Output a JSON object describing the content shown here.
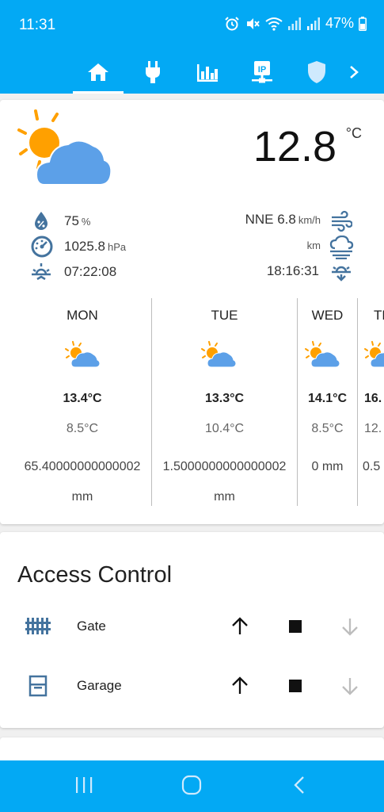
{
  "status_bar": {
    "time": "11:31",
    "battery": "47%"
  },
  "tabs": [
    {
      "icon": "home-icon",
      "active": true
    },
    {
      "icon": "plug-icon",
      "active": false
    },
    {
      "icon": "bar-chart-icon",
      "active": false
    },
    {
      "icon": "ip-network-icon",
      "active": false
    },
    {
      "icon": "shield-icon",
      "active": false
    },
    {
      "icon": "chevron-right-icon",
      "active": false
    }
  ],
  "weather": {
    "current_temp": "12.8",
    "temp_unit": "°C",
    "humidity": "75",
    "humidity_unit": "%",
    "pressure": "1025.8",
    "pressure_unit": "hPa",
    "sunrise": "07:22:08",
    "wind": "NNE 6.8",
    "wind_unit": "km/h",
    "visibility_unit": "km",
    "sunset": "18:16:31",
    "forecast": [
      {
        "day": "MON",
        "high": "13.4°C",
        "low": "8.5°C",
        "rain": "65.40000000000002",
        "rain_unit": "mm"
      },
      {
        "day": "TUE",
        "high": "13.3°C",
        "low": "10.4°C",
        "rain": "1.5000000000000002",
        "rain_unit": "mm"
      },
      {
        "day": "WED",
        "high": "14.1°C",
        "low": "8.5°C",
        "rain": "0 mm",
        "rain_unit": ""
      },
      {
        "day": "THU",
        "high": "16.",
        "low": "12.",
        "rain": "0.5",
        "rain_unit": ""
      }
    ]
  },
  "access_control": {
    "title": "Access Control",
    "items": [
      {
        "label": "Gate",
        "icon": "gate-icon"
      },
      {
        "label": "Garage",
        "icon": "garage-icon"
      }
    ]
  },
  "colors": {
    "primary": "#03a9f4",
    "icon_blue": "#44739e",
    "sun": "#ffa000",
    "cloud": "#5ca0e8"
  }
}
